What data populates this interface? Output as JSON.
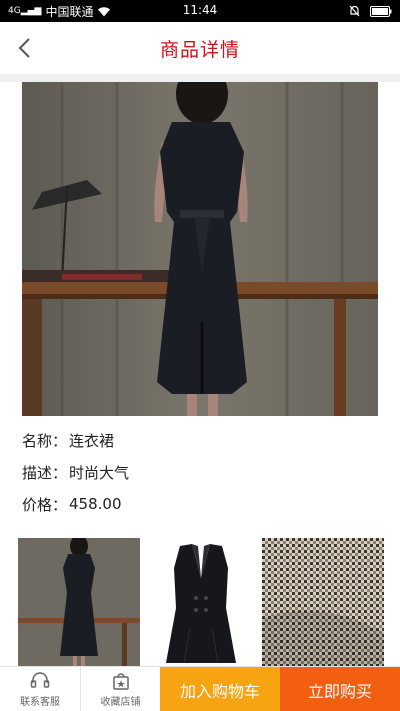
{
  "status_bar": {
    "carrier": "中国联通",
    "time": "11:44",
    "signal": "4G"
  },
  "nav": {
    "title": "商品详情"
  },
  "product": {
    "name_label": "名称：",
    "name": "连衣裙",
    "desc_label": "描述：",
    "desc": "时尚大气",
    "price_label": "价格：",
    "price": "458.00"
  },
  "bottom_bar": {
    "service_label": "联系客服",
    "favorite_label": "收藏店铺",
    "cart_label": "加入购物车",
    "buy_label": "立即购买"
  },
  "colors": {
    "accent": "#c8151d",
    "cart": "#f7a312",
    "buy": "#f35f10"
  }
}
